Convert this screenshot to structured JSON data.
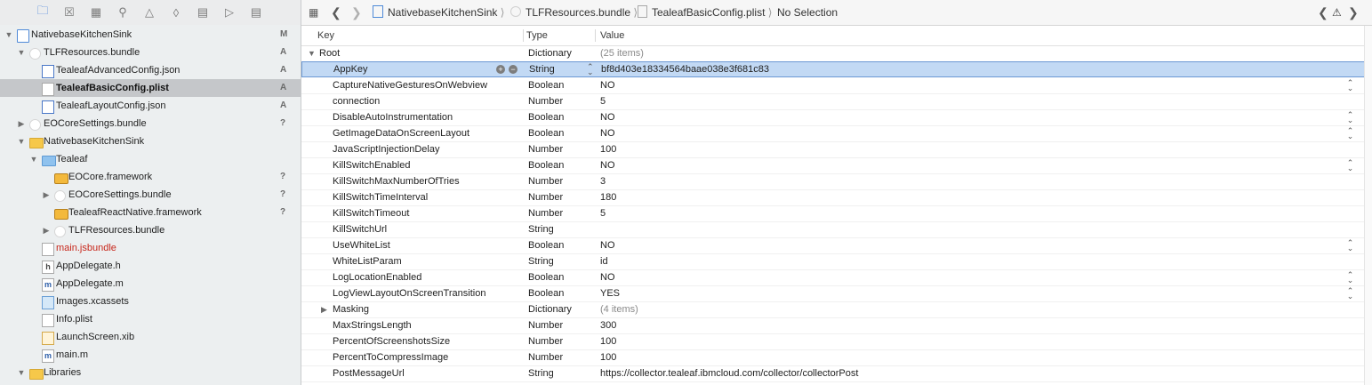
{
  "navigator": {
    "toolbar_icons": [
      "folder-icon",
      "source-control-icon",
      "hierarchy-icon",
      "find-icon",
      "issue-icon",
      "test-icon",
      "debug-icon",
      "breakpoint-icon",
      "report-icon"
    ],
    "tree": [
      {
        "name": "NativebaseKitchenSink",
        "icon": "project",
        "badge": "M",
        "disclosure": "open",
        "indent": 0
      },
      {
        "name": "TLFResources.bundle",
        "icon": "bundle",
        "badge": "A",
        "disclosure": "open",
        "indent": 1
      },
      {
        "name": "TealeafAdvancedConfig.json",
        "icon": "json",
        "badge": "A",
        "disclosure": "",
        "indent": 2
      },
      {
        "name": "TealeafBasicConfig.plist",
        "icon": "file",
        "badge": "A",
        "disclosure": "",
        "indent": 2,
        "selected": true
      },
      {
        "name": "TealeafLayoutConfig.json",
        "icon": "json",
        "badge": "A",
        "disclosure": "",
        "indent": 2
      },
      {
        "name": "EOCoreSettings.bundle",
        "icon": "bundle",
        "badge": "?",
        "disclosure": "closed",
        "indent": 1
      },
      {
        "name": "NativebaseKitchenSink",
        "icon": "folder-yellow",
        "badge": "",
        "disclosure": "open",
        "indent": 1
      },
      {
        "name": "Tealeaf",
        "icon": "folder-blue",
        "badge": "",
        "disclosure": "open",
        "indent": 2
      },
      {
        "name": "EOCore.framework",
        "icon": "framework",
        "badge": "?",
        "disclosure": "",
        "indent": 3
      },
      {
        "name": "EOCoreSettings.bundle",
        "icon": "bundle",
        "badge": "?",
        "disclosure": "closed",
        "indent": 3
      },
      {
        "name": "TealeafReactNative.framework",
        "icon": "framework",
        "badge": "?",
        "disclosure": "",
        "indent": 3
      },
      {
        "name": "TLFResources.bundle",
        "icon": "bundle",
        "badge": "",
        "disclosure": "closed",
        "indent": 3
      },
      {
        "name": "main.jsbundle",
        "icon": "file",
        "badge": "",
        "disclosure": "",
        "indent": 2,
        "red": true
      },
      {
        "name": "AppDelegate.h",
        "icon": "h",
        "badge": "",
        "disclosure": "",
        "indent": 2
      },
      {
        "name": "AppDelegate.m",
        "icon": "m",
        "badge": "",
        "disclosure": "",
        "indent": 2
      },
      {
        "name": "Images.xcassets",
        "icon": "xcassets",
        "badge": "",
        "disclosure": "",
        "indent": 2
      },
      {
        "name": "Info.plist",
        "icon": "file",
        "badge": "",
        "disclosure": "",
        "indent": 2
      },
      {
        "name": "LaunchScreen.xib",
        "icon": "xib",
        "badge": "",
        "disclosure": "",
        "indent": 2
      },
      {
        "name": "main.m",
        "icon": "m",
        "badge": "",
        "disclosure": "",
        "indent": 2
      },
      {
        "name": "Libraries",
        "icon": "folder-yellow",
        "badge": "",
        "disclosure": "open",
        "indent": 1
      }
    ]
  },
  "jumpbar": {
    "crumbs": [
      "NativebaseKitchenSink",
      "TLFResources.bundle",
      "TealeafBasicConfig.plist",
      "No Selection"
    ]
  },
  "columns": {
    "key": "Key",
    "type": "Type",
    "value": "Value"
  },
  "plist": [
    {
      "key": "Root",
      "type": "Dictionary",
      "value": "(25 items)",
      "level": 0,
      "disclosure": "open",
      "dim": true
    },
    {
      "key": "AppKey",
      "type": "String",
      "value": "bf8d403e18334564baae038e3f681c83",
      "level": 1,
      "selected": true
    },
    {
      "key": "CaptureNativeGesturesOnWebview",
      "type": "Boolean",
      "value": "NO",
      "level": 1,
      "stepper": true
    },
    {
      "key": "connection",
      "type": "Number",
      "value": "5",
      "level": 1
    },
    {
      "key": "DisableAutoInstrumentation",
      "type": "Boolean",
      "value": "NO",
      "level": 1,
      "stepper": true
    },
    {
      "key": "GetImageDataOnScreenLayout",
      "type": "Boolean",
      "value": "NO",
      "level": 1,
      "stepper": true
    },
    {
      "key": "JavaScriptInjectionDelay",
      "type": "Number",
      "value": "100",
      "level": 1
    },
    {
      "key": "KillSwitchEnabled",
      "type": "Boolean",
      "value": "NO",
      "level": 1,
      "stepper": true
    },
    {
      "key": "KillSwitchMaxNumberOfTries",
      "type": "Number",
      "value": "3",
      "level": 1
    },
    {
      "key": "KillSwitchTimeInterval",
      "type": "Number",
      "value": "180",
      "level": 1
    },
    {
      "key": "KillSwitchTimeout",
      "type": "Number",
      "value": "5",
      "level": 1
    },
    {
      "key": "KillSwitchUrl",
      "type": "String",
      "value": "",
      "level": 1
    },
    {
      "key": "UseWhiteList",
      "type": "Boolean",
      "value": "NO",
      "level": 1,
      "stepper": true
    },
    {
      "key": "WhiteListParam",
      "type": "String",
      "value": "id",
      "level": 1
    },
    {
      "key": "LogLocationEnabled",
      "type": "Boolean",
      "value": "NO",
      "level": 1,
      "stepper": true
    },
    {
      "key": "LogViewLayoutOnScreenTransition",
      "type": "Boolean",
      "value": "YES",
      "level": 1,
      "stepper": true
    },
    {
      "key": "Masking",
      "type": "Dictionary",
      "value": "(4 items)",
      "level": 1,
      "disclosure": "closed",
      "dim": true
    },
    {
      "key": "MaxStringsLength",
      "type": "Number",
      "value": "300",
      "level": 1
    },
    {
      "key": "PercentOfScreenshotsSize",
      "type": "Number",
      "value": "100",
      "level": 1
    },
    {
      "key": "PercentToCompressImage",
      "type": "Number",
      "value": "100",
      "level": 1
    },
    {
      "key": "PostMessageUrl",
      "type": "String",
      "value": "https://collector.tealeaf.ibmcloud.com/collector/collectorPost",
      "level": 1
    }
  ]
}
